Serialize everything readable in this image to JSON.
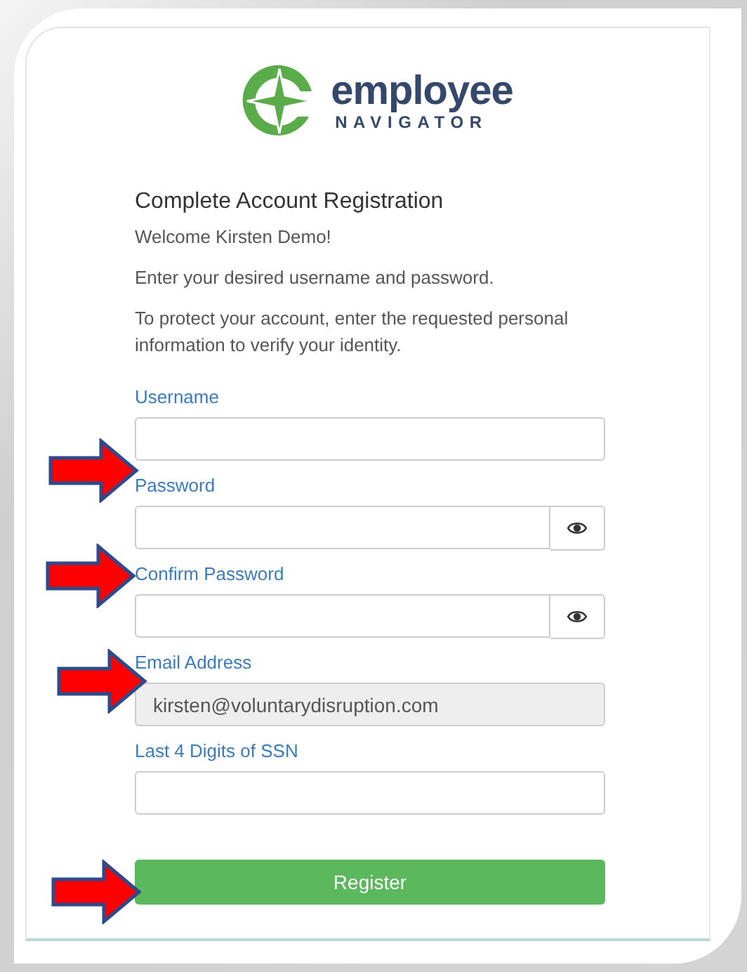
{
  "logo": {
    "wordmark": "employee",
    "subtitle": "NAVIGATOR"
  },
  "heading": "Complete Account Registration",
  "paragraphs": [
    "Welcome Kirsten Demo!",
    "Enter your desired username and password.",
    "To protect your account, enter the requested personal information to verify your identity."
  ],
  "fields": [
    {
      "label": "Username",
      "kind": "text"
    },
    {
      "label": "Password",
      "kind": "password"
    },
    {
      "label": "Confirm Password",
      "kind": "password"
    },
    {
      "label": "Email Address",
      "kind": "readonly",
      "value": "kirsten@voluntarydisruption.com"
    },
    {
      "label": "Last 4 Digits of SSN",
      "kind": "text"
    }
  ],
  "submit": "Register"
}
